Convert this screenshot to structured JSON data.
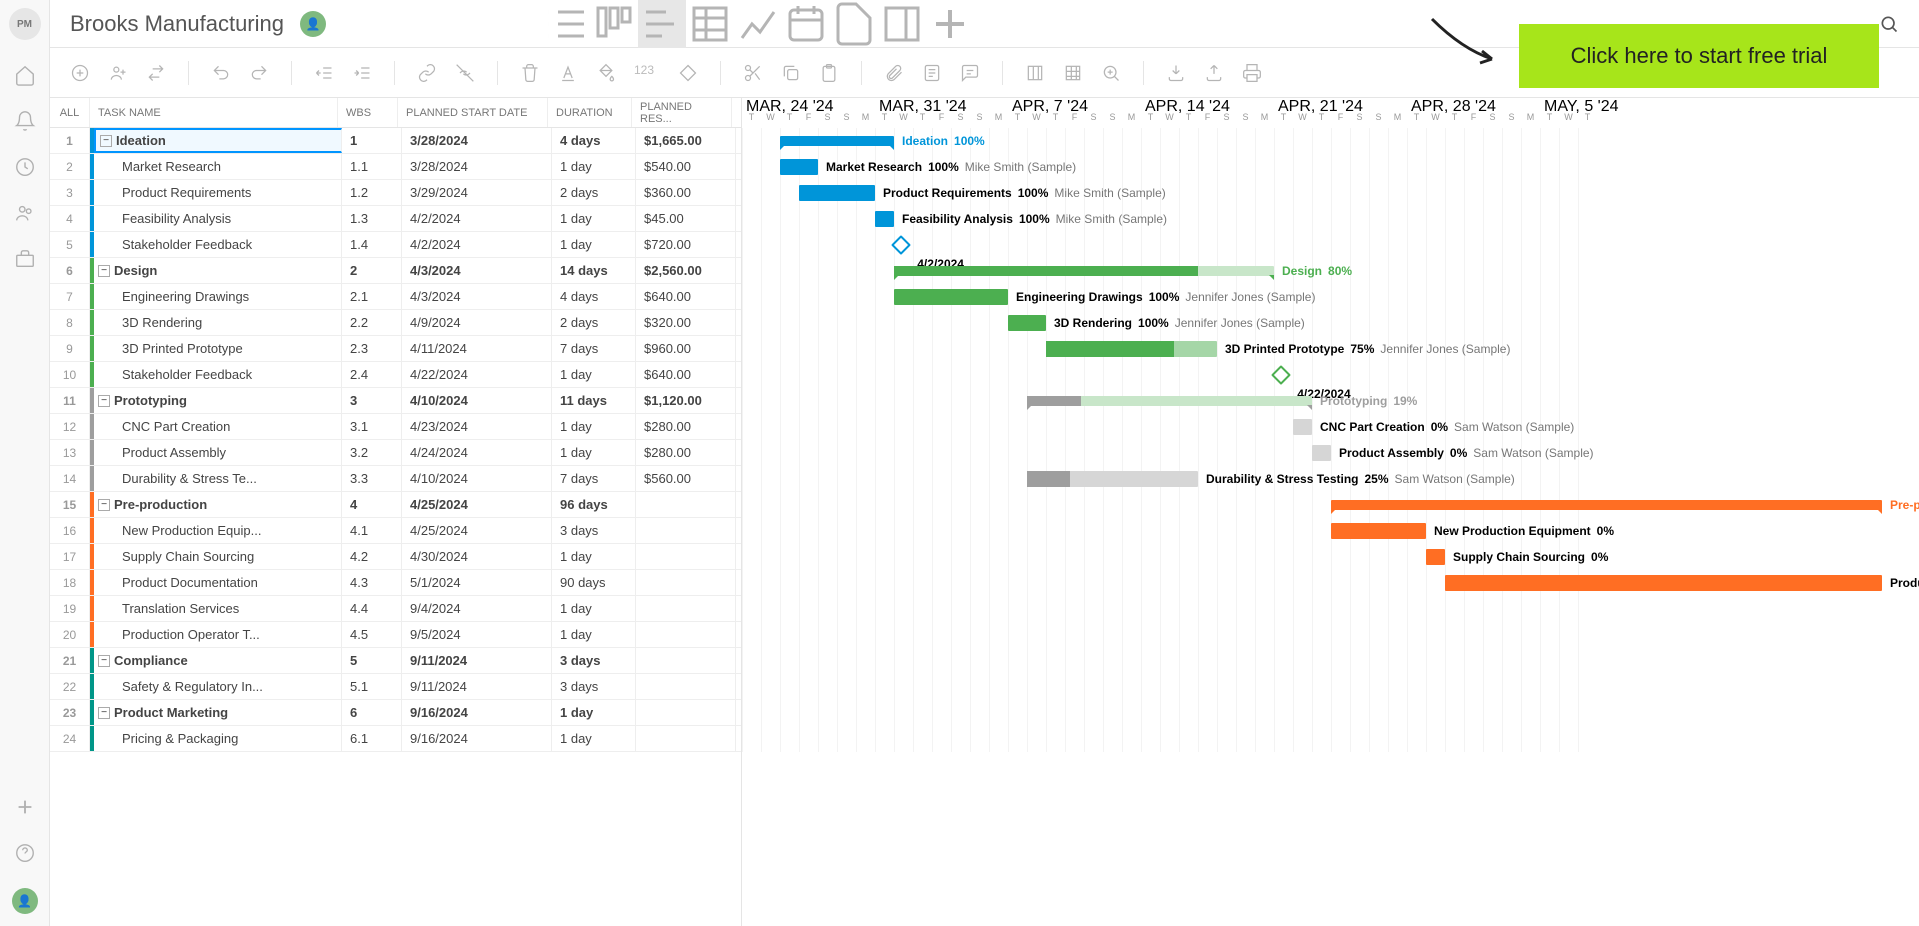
{
  "project": {
    "title": "Brooks Manufacturing"
  },
  "cta": {
    "label": "Click here to start free trial"
  },
  "grid": {
    "headers": {
      "all": "ALL",
      "task": "TASK NAME",
      "wbs": "WBS",
      "start": "PLANNED START DATE",
      "duration": "DURATION",
      "resource": "PLANNED RES..."
    }
  },
  "timeline": {
    "months": [
      "MAR, 24 '24",
      "MAR, 31 '24",
      "APR, 7 '24",
      "APR, 14 '24",
      "APR, 21 '24",
      "APR, 28 '24",
      "MAY, 5 '24"
    ],
    "days": [
      "T",
      "W",
      "T",
      "F",
      "S",
      "S",
      "M",
      "T",
      "W",
      "T",
      "F",
      "S",
      "S",
      "M",
      "T",
      "W",
      "T",
      "F",
      "S",
      "S",
      "M",
      "T",
      "W",
      "T",
      "F",
      "S",
      "S",
      "M",
      "T",
      "W",
      "T",
      "F",
      "S",
      "S",
      "M",
      "T",
      "W",
      "T",
      "F",
      "S",
      "S",
      "M",
      "T",
      "W",
      "T"
    ]
  },
  "tasks": [
    {
      "num": "1",
      "name": "Ideation",
      "wbs": "1",
      "start": "3/28/2024",
      "dur": "4 days",
      "res": "$1,665.00",
      "level": 0,
      "color": "#0095d9",
      "barStart": 2,
      "barEnd": 8,
      "pct": "100%",
      "type": "summary"
    },
    {
      "num": "2",
      "name": "Market Research",
      "wbs": "1.1",
      "start": "3/28/2024",
      "dur": "1 day",
      "res": "$540.00",
      "level": 1,
      "color": "#0095d9",
      "barStart": 2,
      "barEnd": 4,
      "pct": "100%",
      "assignee": "Mike Smith (Sample)",
      "type": "task"
    },
    {
      "num": "3",
      "name": "Product Requirements",
      "wbs": "1.2",
      "start": "3/29/2024",
      "dur": "2 days",
      "res": "$360.00",
      "level": 1,
      "color": "#0095d9",
      "barStart": 3,
      "barEnd": 7,
      "pct": "100%",
      "assignee": "Mike Smith (Sample)",
      "type": "task"
    },
    {
      "num": "4",
      "name": "Feasibility Analysis",
      "wbs": "1.3",
      "start": "4/2/2024",
      "dur": "1 day",
      "res": "$45.00",
      "level": 1,
      "color": "#0095d9",
      "barStart": 7,
      "barEnd": 8,
      "pct": "100%",
      "assignee": "Mike Smith (Sample)",
      "type": "task"
    },
    {
      "num": "5",
      "name": "Stakeholder Feedback",
      "wbs": "1.4",
      "start": "4/2/2024",
      "dur": "1 day",
      "res": "$720.00",
      "level": 1,
      "color": "#0095d9",
      "barStart": 8,
      "barEnd": 8,
      "pct": "",
      "label": "4/2/2024",
      "type": "milestone"
    },
    {
      "num": "6",
      "name": "Design",
      "wbs": "2",
      "start": "4/3/2024",
      "dur": "14 days",
      "res": "$2,560.00",
      "level": 0,
      "color": "#4caf50",
      "barStart": 8,
      "barEnd": 28,
      "pct": "80%",
      "type": "summary",
      "progress": 80
    },
    {
      "num": "7",
      "name": "Engineering Drawings",
      "wbs": "2.1",
      "start": "4/3/2024",
      "dur": "4 days",
      "res": "$640.00",
      "level": 1,
      "color": "#4caf50",
      "barStart": 8,
      "barEnd": 14,
      "pct": "100%",
      "assignee": "Jennifer Jones (Sample)",
      "type": "task"
    },
    {
      "num": "8",
      "name": "3D Rendering",
      "wbs": "2.2",
      "start": "4/9/2024",
      "dur": "2 days",
      "res": "$320.00",
      "level": 1,
      "color": "#4caf50",
      "barStart": 14,
      "barEnd": 16,
      "pct": "100%",
      "assignee": "Jennifer Jones (Sample)",
      "type": "task"
    },
    {
      "num": "9",
      "name": "3D Printed Prototype",
      "wbs": "2.3",
      "start": "4/11/2024",
      "dur": "7 days",
      "res": "$960.00",
      "level": 1,
      "color": "#4caf50",
      "barStart": 16,
      "barEnd": 25,
      "pct": "75%",
      "assignee": "Jennifer Jones (Sample)",
      "type": "task",
      "progress": 75
    },
    {
      "num": "10",
      "name": "Stakeholder Feedback",
      "wbs": "2.4",
      "start": "4/22/2024",
      "dur": "1 day",
      "res": "$640.00",
      "level": 1,
      "color": "#4caf50",
      "barStart": 28,
      "barEnd": 28,
      "pct": "",
      "label": "4/22/2024",
      "type": "milestone"
    },
    {
      "num": "11",
      "name": "Prototyping",
      "wbs": "3",
      "start": "4/10/2024",
      "dur": "11 days",
      "res": "$1,120.00",
      "level": 0,
      "color": "#9e9e9e",
      "barStart": 15,
      "barEnd": 30,
      "pct": "19%",
      "type": "summary",
      "progress": 19
    },
    {
      "num": "12",
      "name": "CNC Part Creation",
      "wbs": "3.1",
      "start": "4/23/2024",
      "dur": "1 day",
      "res": "$280.00",
      "level": 1,
      "color": "#9e9e9e",
      "barStart": 29,
      "barEnd": 30,
      "pct": "0%",
      "assignee": "Sam Watson (Sample)",
      "type": "task",
      "light": true
    },
    {
      "num": "13",
      "name": "Product Assembly",
      "wbs": "3.2",
      "start": "4/24/2024",
      "dur": "1 day",
      "res": "$280.00",
      "level": 1,
      "color": "#9e9e9e",
      "barStart": 30,
      "barEnd": 31,
      "pct": "0%",
      "assignee": "Sam Watson (Sample)",
      "type": "task",
      "light": true
    },
    {
      "num": "14",
      "name": "Durability & Stress Te...",
      "wbs": "3.3",
      "start": "4/10/2024",
      "dur": "7 days",
      "res": "$560.00",
      "level": 1,
      "color": "#9e9e9e",
      "barStart": 15,
      "barEnd": 24,
      "pct": "25%",
      "assignee": "Sam Watson (Sample)",
      "fullName": "Durability & Stress Testing",
      "type": "task",
      "progress": 25,
      "light": true
    },
    {
      "num": "15",
      "name": "Pre-production",
      "wbs": "4",
      "start": "4/25/2024",
      "dur": "96 days",
      "res": "",
      "level": 0,
      "color": "#ff6e23",
      "barStart": 31,
      "barEnd": 60,
      "pct": "",
      "type": "summary"
    },
    {
      "num": "16",
      "name": "New Production Equip...",
      "wbs": "4.1",
      "start": "4/25/2024",
      "dur": "3 days",
      "res": "",
      "level": 1,
      "color": "#ff6e23",
      "barStart": 31,
      "barEnd": 36,
      "pct": "0%",
      "fullName": "New Production Equipment",
      "type": "task"
    },
    {
      "num": "17",
      "name": "Supply Chain Sourcing",
      "wbs": "4.2",
      "start": "4/30/2024",
      "dur": "1 day",
      "res": "",
      "level": 1,
      "color": "#ff6e23",
      "barStart": 36,
      "barEnd": 37,
      "pct": "0%",
      "type": "task"
    },
    {
      "num": "18",
      "name": "Product Documentation",
      "wbs": "4.3",
      "start": "5/1/2024",
      "dur": "90 days",
      "res": "",
      "level": 1,
      "color": "#ff6e23",
      "barStart": 37,
      "barEnd": 60,
      "pct": "",
      "type": "task"
    },
    {
      "num": "19",
      "name": "Translation Services",
      "wbs": "4.4",
      "start": "9/4/2024",
      "dur": "1 day",
      "res": "",
      "level": 1,
      "color": "#ff6e23",
      "type": "none"
    },
    {
      "num": "20",
      "name": "Production Operator T...",
      "wbs": "4.5",
      "start": "9/5/2024",
      "dur": "1 day",
      "res": "",
      "level": 1,
      "color": "#ff6e23",
      "type": "none"
    },
    {
      "num": "21",
      "name": "Compliance",
      "wbs": "5",
      "start": "9/11/2024",
      "dur": "3 days",
      "res": "",
      "level": 0,
      "color": "#009688",
      "type": "none"
    },
    {
      "num": "22",
      "name": "Safety & Regulatory In...",
      "wbs": "5.1",
      "start": "9/11/2024",
      "dur": "3 days",
      "res": "",
      "level": 1,
      "color": "#009688",
      "type": "none"
    },
    {
      "num": "23",
      "name": "Product Marketing",
      "wbs": "6",
      "start": "9/16/2024",
      "dur": "1 day",
      "res": "",
      "level": 0,
      "color": "#009688",
      "type": "none"
    },
    {
      "num": "24",
      "name": "Pricing & Packaging",
      "wbs": "6.1",
      "start": "9/16/2024",
      "dur": "1 day",
      "res": "",
      "level": 1,
      "color": "#009688",
      "type": "none"
    }
  ]
}
